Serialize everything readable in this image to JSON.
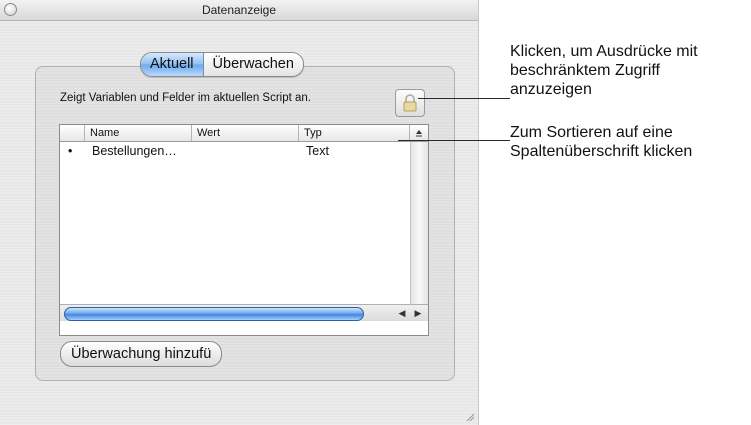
{
  "window": {
    "title": "Datenanzeige"
  },
  "tabs": [
    {
      "label": "Aktuell",
      "selected": true
    },
    {
      "label": "Überwachen",
      "selected": false
    }
  ],
  "description": "Zeigt Variablen und Felder im aktuellen Script an.",
  "table": {
    "columns": [
      "Name",
      "Wert",
      "Typ"
    ],
    "rows": [
      {
        "bullet": "•",
        "name": "Bestellungen…",
        "value": "",
        "type": "Text"
      }
    ]
  },
  "buttons": {
    "add_watch": "Überwachung hinzufü"
  },
  "annotations": {
    "lock": [
      "Klicken, um Ausdrücke mit",
      "beschränktem Zugriff",
      "anzuzeigen"
    ],
    "sort": [
      "Zum Sortieren auf eine",
      "Spaltenüberschrift klicken"
    ]
  },
  "colors": {
    "selected_segment": "#8fc0f1",
    "scroll_thumb": "#3f86e0"
  },
  "icons": [
    "close-icon",
    "lock-icon",
    "sort-icon",
    "scroll-left-icon",
    "scroll-right-icon",
    "resize-grip-icon"
  ]
}
